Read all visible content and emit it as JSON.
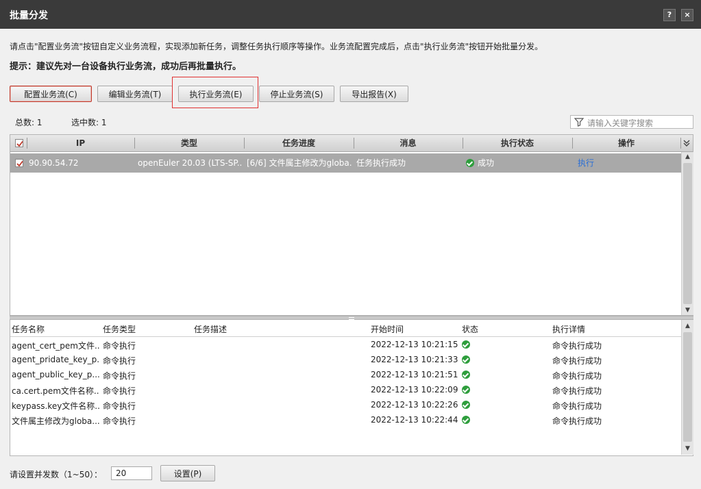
{
  "window": {
    "title": "批量分发",
    "help_label": "?",
    "close_label": "×"
  },
  "description": "请点击\"配置业务流\"按钮自定义业务流程，实现添加新任务，调整任务执行顺序等操作。业务流配置完成后，点击\"执行业务流\"按钮开始批量分发。",
  "hint": "提示：建议先对一台设备执行业务流，成功后再批量执行。",
  "toolbar": {
    "configure": "配置业务流(C)",
    "edit": "编辑业务流(T)",
    "execute": "执行业务流(E)",
    "stop": "停止业务流(S)",
    "export": "导出报告(X)"
  },
  "summary": {
    "total_label": "总数:",
    "total": "1",
    "selected_label": "选中数:",
    "selected": "1"
  },
  "search": {
    "placeholder": "请输入关键字搜索"
  },
  "device_table": {
    "columns": [
      "IP",
      "类型",
      "任务进度",
      "消息",
      "执行状态",
      "操作"
    ],
    "rows": [
      {
        "ip": "90.90.54.72",
        "type": "openEuler 20.03 (LTS-SP...",
        "progress": "[6/6] 文件属主修改为globa...",
        "message": "任务执行成功",
        "status": "成功",
        "action": "执行"
      }
    ]
  },
  "task_table": {
    "columns": [
      "任务名称",
      "任务类型",
      "任务描述",
      "开始时间",
      "状态",
      "执行详情"
    ],
    "rows": [
      {
        "name": "agent_cert_pem文件...",
        "type": "命令执行",
        "desc": "",
        "start": "2022-12-13 10:21:15",
        "status": "成功",
        "detail": "命令执行成功"
      },
      {
        "name": "agent_pridate_key_p...",
        "type": "命令执行",
        "desc": "",
        "start": "2022-12-13 10:21:33",
        "status": "成功",
        "detail": "命令执行成功"
      },
      {
        "name": "agent_public_key_p...",
        "type": "命令执行",
        "desc": "",
        "start": "2022-12-13 10:21:51",
        "status": "成功",
        "detail": "命令执行成功"
      },
      {
        "name": "ca.cert.pem文件名称...",
        "type": "命令执行",
        "desc": "",
        "start": "2022-12-13 10:22:09",
        "status": "成功",
        "detail": "命令执行成功"
      },
      {
        "name": "keypass.key文件名称...",
        "type": "命令执行",
        "desc": "",
        "start": "2022-12-13 10:22:26",
        "status": "成功",
        "detail": "命令执行成功"
      },
      {
        "name": "文件属主修改为globa...",
        "type": "命令执行",
        "desc": "",
        "start": "2022-12-13 10:22:44",
        "status": "成功",
        "detail": "命令执行成功"
      }
    ]
  },
  "footer": {
    "concurrency_label": "请设置并发数（1~50）：",
    "concurrency_value": "20",
    "set_button": "设置(P)"
  },
  "colors": {
    "title_bar": "#3a3a3a",
    "selected_row": "#a9a9a9",
    "success": "#2e9e3c",
    "link": "#2a6fd6",
    "highlight": "#e03030"
  },
  "icons": {
    "status": "success-check-icon",
    "search": "filter-icon",
    "checkbox": "checkbox-checked-icon"
  }
}
